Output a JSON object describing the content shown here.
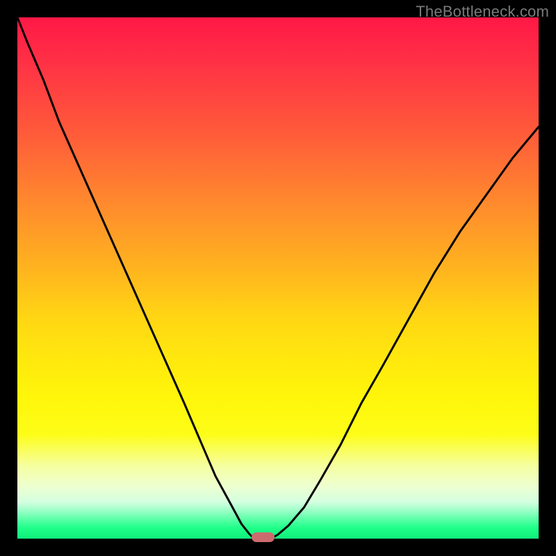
{
  "watermark": "TheBottleneck.com",
  "chart_data": {
    "type": "line",
    "title": "",
    "xlabel": "",
    "ylabel": "",
    "xlim": [
      0,
      100
    ],
    "ylim": [
      0,
      100
    ],
    "grid": false,
    "legend": false,
    "series": [
      {
        "name": "left-curve",
        "x": [
          0,
          2,
          5,
          8,
          12,
          16,
          20,
          24,
          28,
          32,
          35,
          38,
          41,
          43,
          44.5,
          45.2
        ],
        "values": [
          100,
          95,
          88,
          80,
          71,
          62,
          53,
          44,
          35,
          26,
          19,
          12,
          6.5,
          2.8,
          0.9,
          0.2
        ]
      },
      {
        "name": "right-curve",
        "x": [
          49,
          50,
          52,
          55,
          58,
          62,
          66,
          70,
          75,
          80,
          85,
          90,
          95,
          100
        ],
        "values": [
          0.2,
          0.8,
          2.5,
          6,
          11,
          18,
          26,
          33,
          42,
          51,
          59,
          66,
          73,
          79
        ]
      }
    ],
    "marker": {
      "x_range": [
        45.2,
        49.0
      ],
      "y": 0.3,
      "color": "#cc6b6e"
    },
    "background_gradient": {
      "top": "#ff1846",
      "mid": "#ffe90e",
      "bottom": "#10f07c"
    }
  }
}
